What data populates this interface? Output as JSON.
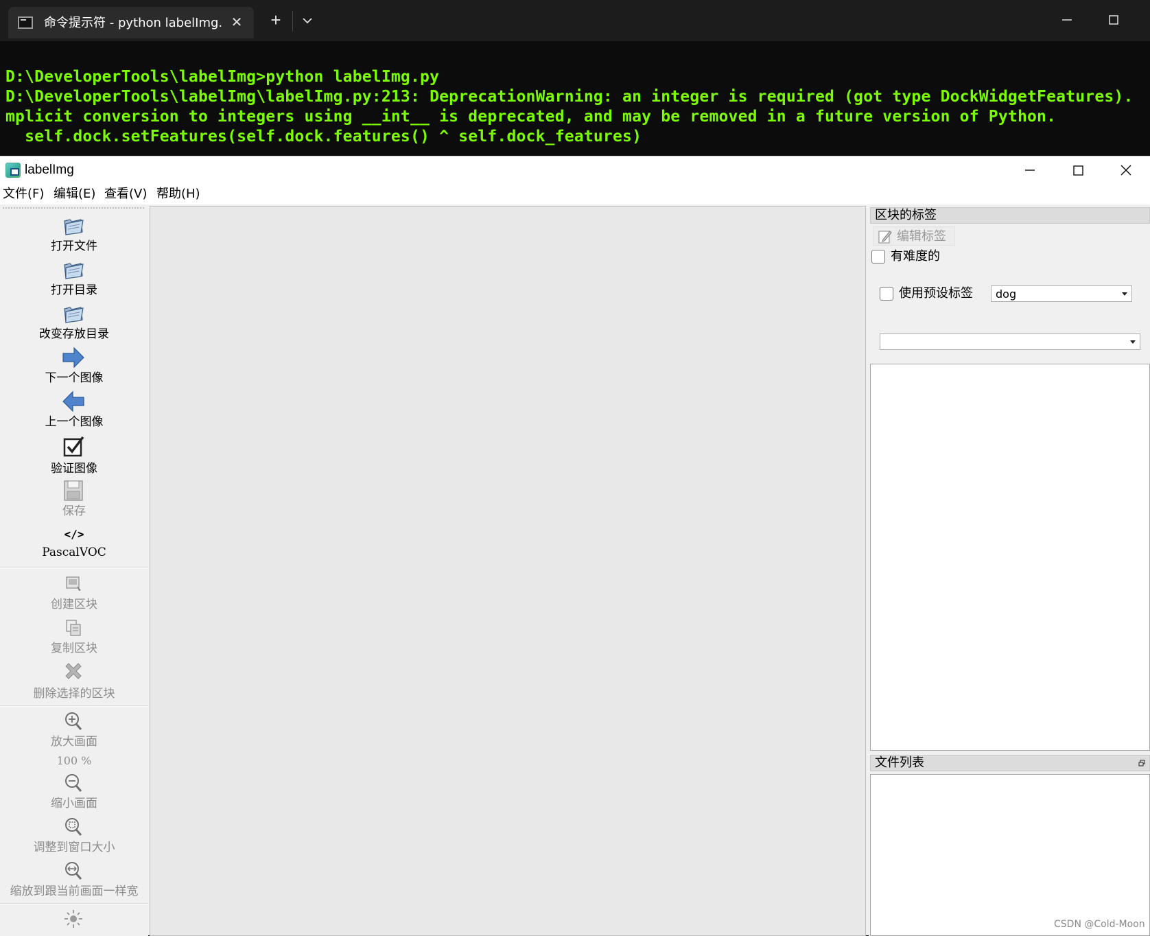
{
  "terminal": {
    "tab_title": "命令提示符 - python  labelImg.py",
    "close_glyph": "✕",
    "new_tab_glyph": "+",
    "lines": [
      "D:\\DeveloperTools\\labelImg>python labelImg.py",
      "D:\\DeveloperTools\\labelImg\\labelImg.py:213: DeprecationWarning: an integer is required (got type DockWidgetFeatures).  I",
      "mplicit conversion to integers using __int__ is deprecated, and may be removed in a future version of Python.",
      "  self.dock.setFeatures(self.dock.features() ^ self.dock_features)"
    ]
  },
  "app": {
    "title": "labelImg",
    "menu": [
      "文件(F)",
      "编辑(E)",
      "查看(V)",
      "帮助(H)"
    ],
    "toolbar": {
      "open_file": "打开文件",
      "open_dir": "打开目录",
      "change_save_dir": "改变存放目录",
      "next_image": "下一个图像",
      "prev_image": "上一个图像",
      "verify_image": "验证图像",
      "save": "保存",
      "format_glyph": "</>",
      "format": "PascalVOC",
      "create_box": "创建区块",
      "duplicate_box": "复制区块",
      "delete_box": "删除选择的区块",
      "zoom_in": "放大画面",
      "zoom_level": "100 %",
      "zoom_out": "缩小画面",
      "fit_window": "调整到窗口大小",
      "fit_width": "缩放到跟当前画面一样宽"
    },
    "dock": {
      "box_labels_title": "区块的标签",
      "edit_label": "编辑标签",
      "difficult": "有难度的",
      "use_default_label": "使用预设标签",
      "default_label_value": "dog",
      "file_list_title": "文件列表"
    }
  },
  "watermark": "CSDN @Cold-Moon"
}
